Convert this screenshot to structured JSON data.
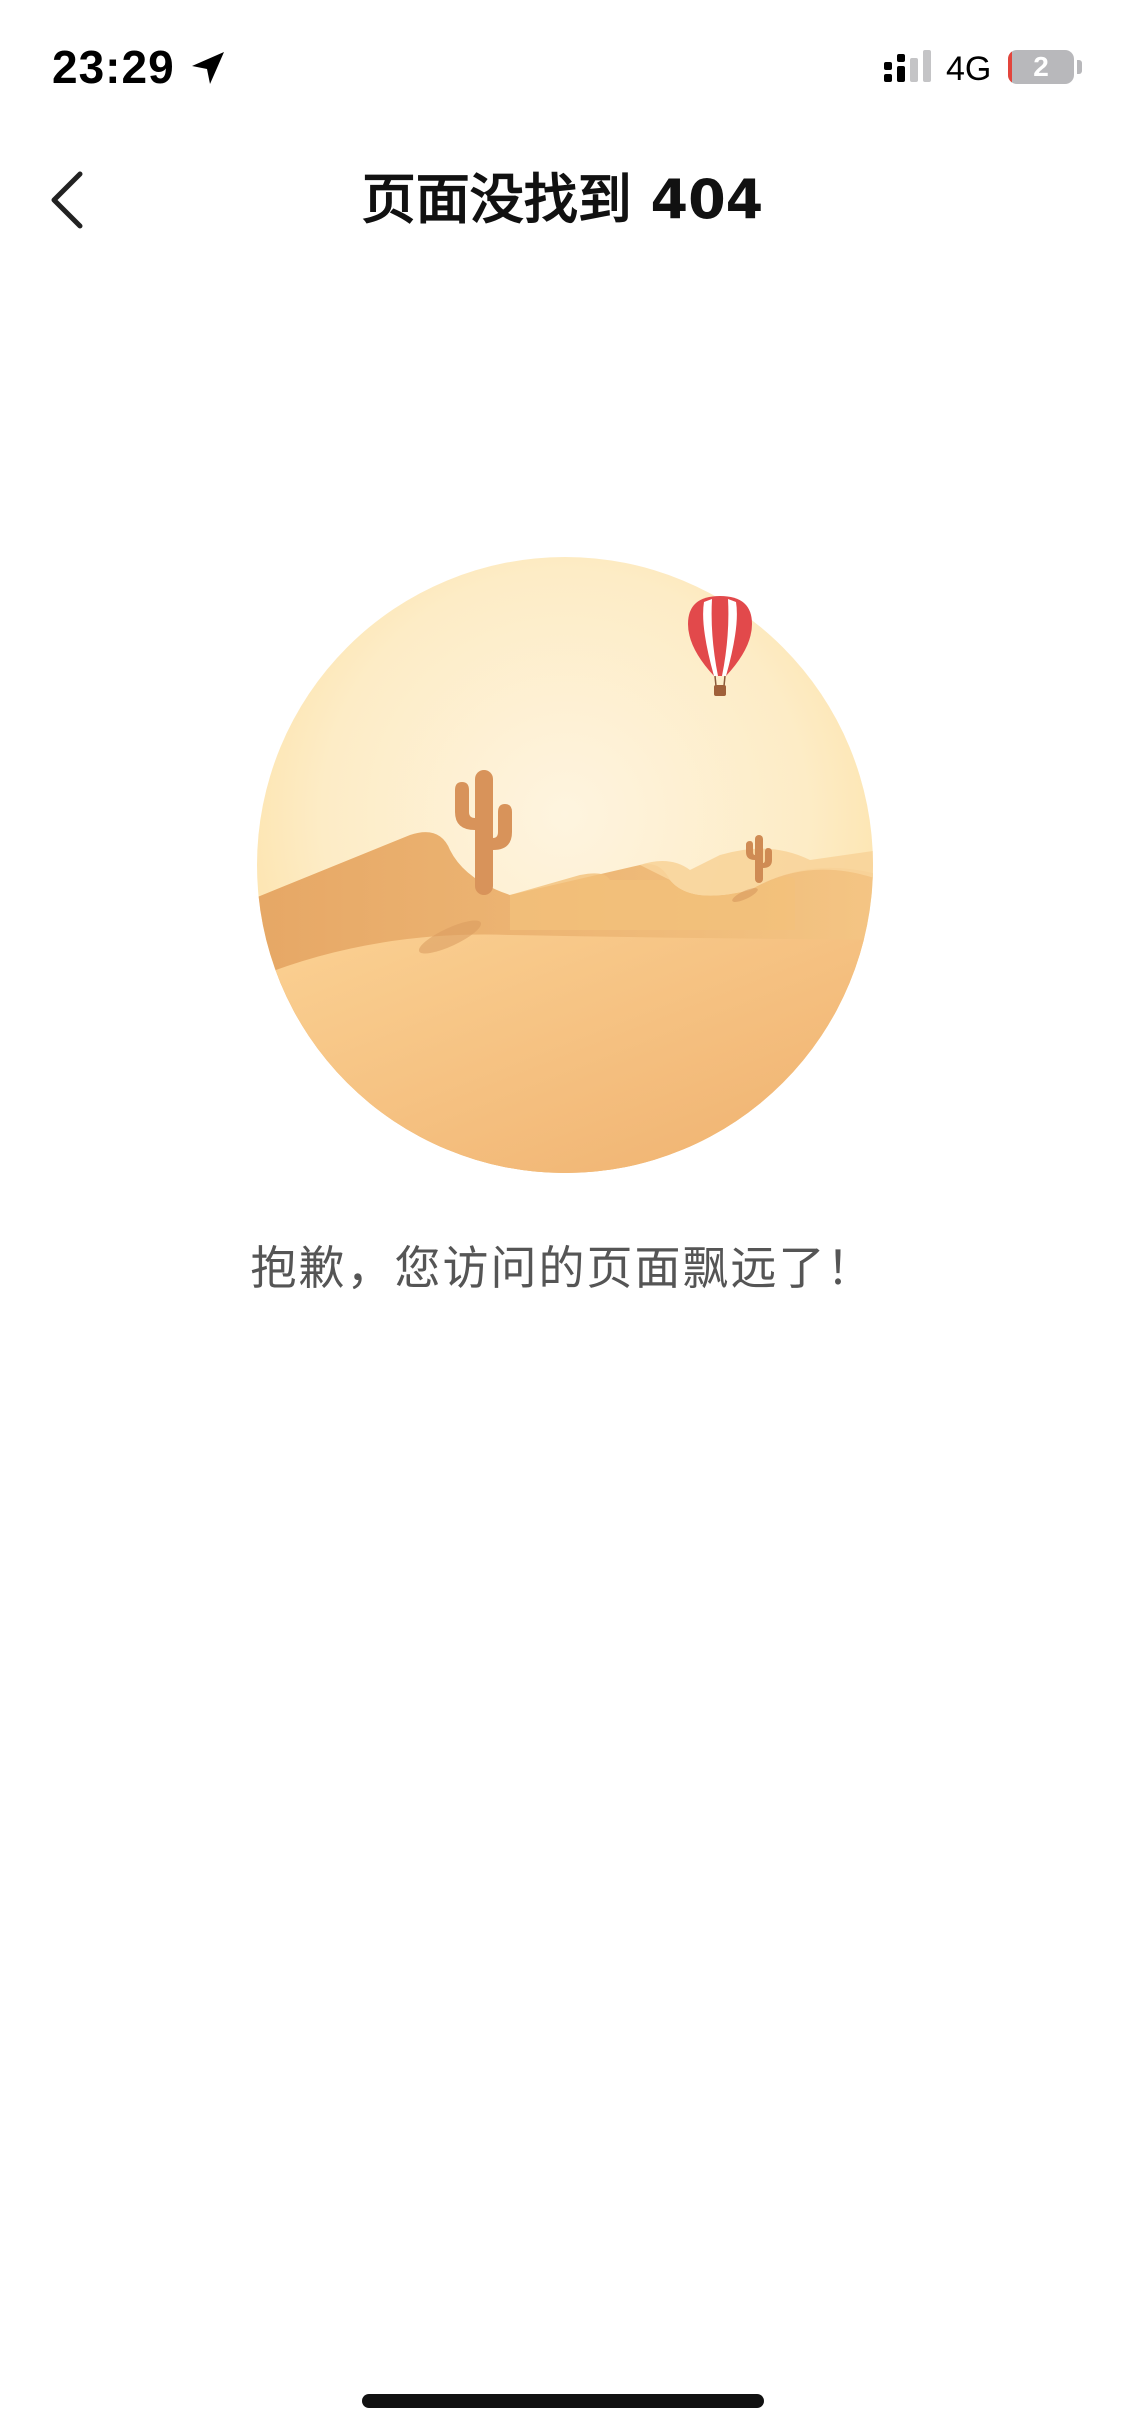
{
  "status_bar": {
    "time": "23:29",
    "network": "4G",
    "battery_percent": "2",
    "battery_level": 0.02,
    "icons": [
      "location-arrow-icon",
      "signal-icon",
      "battery-icon"
    ]
  },
  "nav": {
    "title": "页面没找到 404",
    "back_icon": "chevron-left-icon"
  },
  "content": {
    "illustration": "desert-balloon-illustration",
    "message": "抱歉，您访问的页面飘远了！"
  },
  "colors": {
    "sky_light": "#fdf1d6",
    "sky_edge": "#fde6b4",
    "dune_light": "#f9cf8f",
    "dune_dark": "#e9ad6c",
    "cactus": "#d8935a",
    "balloon_red": "#e2494b",
    "text_gray": "#555555"
  }
}
